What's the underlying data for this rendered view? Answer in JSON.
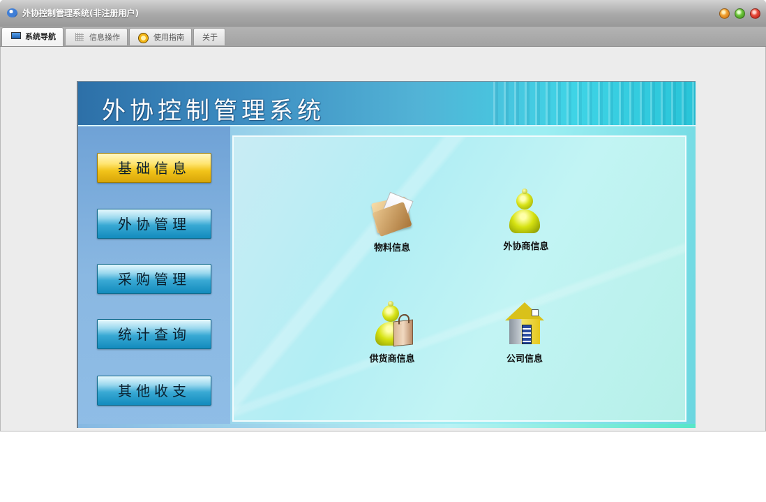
{
  "window": {
    "title": "外协控制管理系统(非注册用户)"
  },
  "tabs": [
    {
      "label": "系统导航",
      "icon": "monitor-icon",
      "active": true
    },
    {
      "label": "信息操作",
      "icon": "grid-icon",
      "active": false
    },
    {
      "label": "使用指南",
      "icon": "compass-icon",
      "active": false
    },
    {
      "label": "关于",
      "icon": "",
      "active": false
    }
  ],
  "panel": {
    "title": "外协控制管理系统"
  },
  "sidebar": {
    "items": [
      {
        "label": "基础信息",
        "active": true
      },
      {
        "label": "外协管理",
        "active": false
      },
      {
        "label": "采购管理",
        "active": false
      },
      {
        "label": "统计查询",
        "active": false
      },
      {
        "label": "其他收支",
        "active": false
      }
    ]
  },
  "content": {
    "tiles": [
      {
        "label": "物料信息",
        "icon": "folder-icon"
      },
      {
        "label": "外协商信息",
        "icon": "person-icon"
      },
      {
        "label": "供货商信息",
        "icon": "person-bag-icon"
      },
      {
        "label": "公司信息",
        "icon": "house-icon"
      }
    ]
  },
  "colors": {
    "accent_blue": "#138bbd",
    "active_gold": "#f2c41a"
  }
}
